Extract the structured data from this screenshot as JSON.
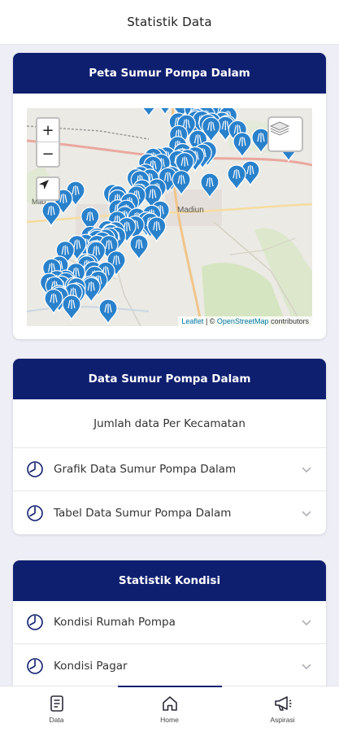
{
  "header": {
    "title": "Statistik Data"
  },
  "map_card": {
    "title": "Peta Sumur Pompa Dalam",
    "map": {
      "zoom_in": "+",
      "zoom_out": "−",
      "place_labels": [
        "Madiun",
        "Mad"
      ],
      "attribution": {
        "leaflet": "Leaflet",
        "separator": " | © ",
        "osm": "OpenStreetMap",
        "suffix": " contributors"
      }
    }
  },
  "data_card": {
    "title": "Data Sumur Pompa Dalam",
    "subtitle": "Jumlah data Per Kecamatan",
    "items": [
      {
        "label": "Grafik Data Sumur Pompa Dalam"
      },
      {
        "label": "Tabel Data Sumur Pompa Dalam"
      }
    ]
  },
  "kondisi_card": {
    "title": "Statistik Kondisi",
    "items": [
      {
        "label": "Kondisi Rumah Pompa"
      },
      {
        "label": "Kondisi Pagar"
      }
    ]
  },
  "bottom_nav": {
    "items": [
      {
        "label": "Data",
        "icon": "document-icon"
      },
      {
        "label": "Home",
        "icon": "home-icon"
      },
      {
        "label": "Aspirasi",
        "icon": "megaphone-icon"
      }
    ],
    "active": "Home"
  },
  "colors": {
    "primary": "#0f1f70",
    "marker": "#2a81cb",
    "background": "#eeeef6"
  }
}
